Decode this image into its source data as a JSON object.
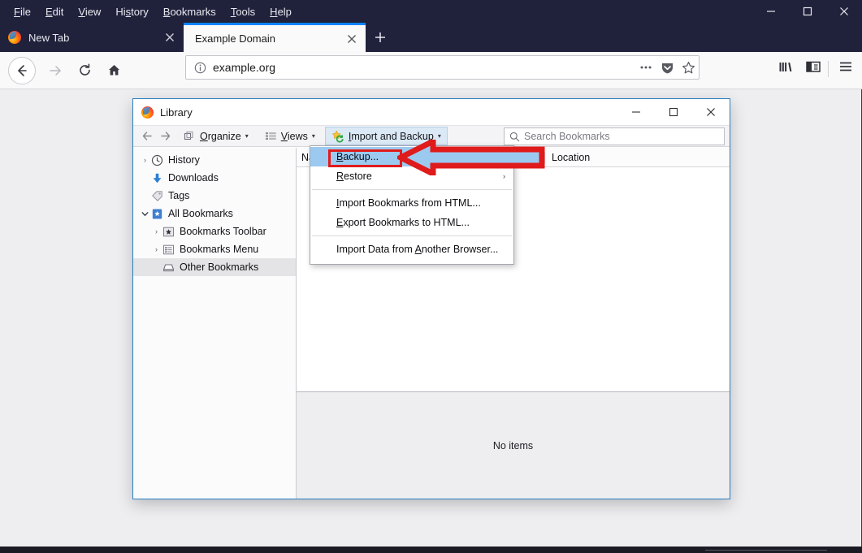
{
  "browser": {
    "menubar": [
      {
        "label": "File",
        "accel": "F"
      },
      {
        "label": "Edit",
        "accel": "E"
      },
      {
        "label": "View",
        "accel": "V"
      },
      {
        "label": "History",
        "accel": "s"
      },
      {
        "label": "Bookmarks",
        "accel": "B"
      },
      {
        "label": "Tools",
        "accel": "T"
      },
      {
        "label": "Help",
        "accel": "H"
      }
    ],
    "window_controls": {
      "minimize": "minimize-icon",
      "maximize": "maximize-icon",
      "close": "close-icon"
    },
    "tabs": [
      {
        "title": "New Tab",
        "active": false,
        "favicon": "firefox-icon",
        "close": "close-icon"
      },
      {
        "title": "Example Domain",
        "active": true,
        "close": "close-icon"
      }
    ],
    "new_tab_button": "+",
    "nav": {
      "back": "back-arrow-icon",
      "forward": "forward-arrow-icon",
      "reload": "reload-icon",
      "home": "home-icon"
    },
    "urlbar": {
      "value": "example.org",
      "identity_icon": "info-icon",
      "page_actions_icon": "ellipsis-icon",
      "pocket_icon": "pocket-shield-icon",
      "bookmark_icon": "star-icon"
    },
    "toolbar_right": {
      "library": "library-icon",
      "sidebar": "sidebar-icon",
      "menu": "hamburger-menu-icon"
    }
  },
  "library": {
    "title": "Library",
    "favicon": "firefox-icon",
    "window_controls": {
      "minimize": "minimize-icon",
      "maximize": "maximize-icon",
      "close": "close-icon"
    },
    "toolbar": {
      "back": "back-arrow-icon",
      "forward": "forward-arrow-icon",
      "organize": {
        "label": "Organize",
        "accel": "O",
        "icon": "organize-icon",
        "caret": "▾"
      },
      "views": {
        "label": "Views",
        "accel": "V",
        "icon": "views-list-icon",
        "caret": "▾"
      },
      "import_and_backup": {
        "label": "Import and Backup",
        "accel": "I",
        "icon": "star-sync-icon",
        "caret": "▾",
        "state": "open"
      }
    },
    "search": {
      "placeholder": "Search Bookmarks",
      "icon": "search-icon",
      "value": ""
    },
    "sidebar": [
      {
        "label": "History",
        "icon": "clock-icon",
        "twisty": "›",
        "indent": 0,
        "selected": false
      },
      {
        "label": "Downloads",
        "icon": "download-arrow-icon",
        "twisty": "",
        "indent": 1,
        "selected": false
      },
      {
        "label": "Tags",
        "icon": "tag-icon",
        "twisty": "",
        "indent": 1,
        "selected": false
      },
      {
        "label": "All Bookmarks",
        "icon": "bookmarks-book-icon",
        "twisty": "⌄",
        "indent": 0,
        "selected": false
      },
      {
        "label": "Bookmarks Toolbar",
        "icon": "star-folder-icon",
        "twisty": "›",
        "indent": 1,
        "selected": false
      },
      {
        "label": "Bookmarks Menu",
        "icon": "menu-folder-icon",
        "twisty": "›",
        "indent": 1,
        "selected": false
      },
      {
        "label": "Other Bookmarks",
        "icon": "tray-folder-icon",
        "twisty": "",
        "indent": 2,
        "selected": true
      }
    ],
    "columns": [
      {
        "label": "Name"
      },
      {
        "label": "Location"
      }
    ],
    "rows": [],
    "detail_pane": {
      "empty_text": "No items"
    }
  },
  "dropdown_menu": {
    "items": [
      {
        "label": "Backup...",
        "accel": "B",
        "highlighted": true,
        "submenu": false,
        "separator_after": false
      },
      {
        "label": "Restore",
        "accel": "R",
        "highlighted": false,
        "submenu": true,
        "submenu_arrow": "›",
        "separator_after": true
      },
      {
        "label": "Import Bookmarks from HTML...",
        "accel": "I",
        "highlighted": false,
        "submenu": false,
        "separator_after": false
      },
      {
        "label": "Export Bookmarks to HTML...",
        "accel": "E",
        "highlighted": false,
        "submenu": false,
        "separator_after": true
      },
      {
        "label": "Import Data from Another Browser...",
        "accel": "A",
        "highlighted": false,
        "submenu": false,
        "separator_after": false
      }
    ]
  },
  "annotations": {
    "highlight_color": "#e01b1b",
    "arrow_fill": "#9cc9f0",
    "arrow_stroke": "#e01b1b",
    "arrow_direction": "left",
    "target": "Backup..."
  }
}
